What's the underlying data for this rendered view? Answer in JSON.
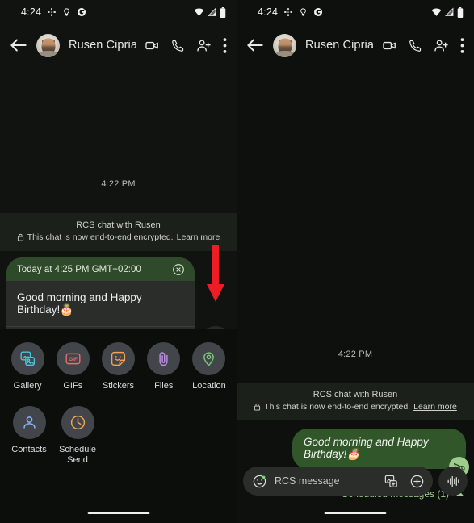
{
  "status_bar": {
    "time": "4:24",
    "icons_left": [
      "pinwheel-icon",
      "lightbulb-icon",
      "google-g-icon"
    ],
    "icons_right": [
      "wifi-icon",
      "signal-icon",
      "battery-icon"
    ]
  },
  "toolbar": {
    "back_icon": "back-arrow-icon",
    "contact_name": "Rusen Ciprian",
    "video_call_icon": "video-call-icon",
    "call_icon": "phone-call-icon",
    "add_person_icon": "add-person-icon",
    "overflow_icon": "more-options-icon"
  },
  "chat": {
    "timestamp": "4:22 PM",
    "encryption": {
      "title": "RCS chat with Rusen",
      "subtitle": "This chat is now end-to-end encrypted.",
      "link": "Learn more",
      "lock_icon": "lock-icon"
    }
  },
  "left_panel": {
    "compose": {
      "scheduled_header": "Today at 4:25 PM GMT+02:00",
      "close_icon": "close-circle-icon",
      "message_text": "Good morning and Happy Birthday!🎂",
      "emoji_icon": "emoji-icon",
      "gallery_icon": "gallery-icon",
      "plus_icon": "plus-icon",
      "send_schedule_icon": "schedule-send-icon"
    },
    "annotation": {
      "arrow_icon": "red-down-arrow",
      "color": "#ee1c25"
    },
    "attachments": [
      {
        "label": "Gallery",
        "icon": "gallery-icon",
        "color": "#4fc3d9"
      },
      {
        "label": "GIFs",
        "icon": "gif-icon",
        "color": "#ef6d6d"
      },
      {
        "label": "Stickers",
        "icon": "sticker-icon",
        "color": "#f0a355"
      },
      {
        "label": "Files",
        "icon": "paperclip-icon",
        "color": "#b88ee0"
      },
      {
        "label": "Location",
        "icon": "location-pin-icon",
        "color": "#7bc67b"
      },
      {
        "label": "Contacts",
        "icon": "contact-person-icon",
        "color": "#8ab4f8"
      },
      {
        "label": "Schedule\nSend",
        "icon": "clock-icon",
        "color": "#f0a355"
      }
    ]
  },
  "right_panel": {
    "sent_message": "Good morning and Happy Birthday!🎂",
    "sent_badge_icon": "schedule-send-badge-icon",
    "scheduled_summary": "Scheduled messages (1)",
    "scheduled_chevron": "chevron-up-icon",
    "input": {
      "placeholder": "RCS message",
      "emoji_icon": "emoji-icon",
      "gallery_icon": "gallery-icon",
      "plus_icon": "plus-icon",
      "voice_icon": "voice-waveform-icon"
    }
  },
  "colors": {
    "background": "#111311",
    "bubble_green": "#31562a",
    "scheduled_header_green": "#2f4a2a",
    "accent_green": "#a3cc93",
    "arrow_red": "#ee1c25"
  }
}
